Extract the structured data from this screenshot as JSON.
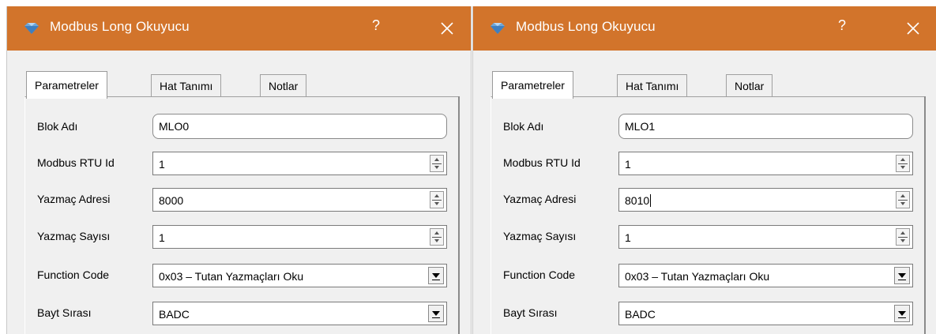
{
  "windows": [
    {
      "title": "Modbus Long Okuyucu",
      "help_label": "?",
      "tabs": [
        {
          "label": "Parametreler",
          "active": true
        },
        {
          "label": "Hat Tanımı",
          "active": false
        },
        {
          "label": "Notlar",
          "active": false
        }
      ],
      "fields": {
        "block_name": {
          "label": "Blok Adı",
          "value": "MLO0"
        },
        "rtu_id": {
          "label": "Modbus RTU Id",
          "value": "1"
        },
        "register_address": {
          "label": "Yazmaç Adresi",
          "value": "8000"
        },
        "register_count": {
          "label": "Yazmaç Sayısı",
          "value": "1"
        },
        "function_code": {
          "label": "Function Code",
          "value": "0x03 – Tutan Yazmaçları Oku"
        },
        "byte_order": {
          "label": "Bayt Sırası",
          "value": "BADC"
        }
      }
    },
    {
      "title": "Modbus Long Okuyucu",
      "help_label": "?",
      "tabs": [
        {
          "label": "Parametreler",
          "active": true
        },
        {
          "label": "Hat Tanımı",
          "active": false
        },
        {
          "label": "Notlar",
          "active": false
        }
      ],
      "fields": {
        "block_name": {
          "label": "Blok Adı",
          "value": "MLO1"
        },
        "rtu_id": {
          "label": "Modbus RTU Id",
          "value": "1"
        },
        "register_address": {
          "label": "Yazmaç Adresi",
          "value": "8010"
        },
        "register_count": {
          "label": "Yazmaç Sayısı",
          "value": "1"
        },
        "function_code": {
          "label": "Function Code",
          "value": "0x03 – Tutan Yazmaçları Oku"
        },
        "byte_order": {
          "label": "Bayt Sırası",
          "value": "BADC"
        }
      }
    }
  ],
  "colors": {
    "titlebar": "#d2742b",
    "dialog_bg": "#f0f0f0"
  },
  "icons": [
    "diamond-app-icon",
    "close-icon",
    "spinner-icon",
    "dropdown-arrow-icon"
  ]
}
